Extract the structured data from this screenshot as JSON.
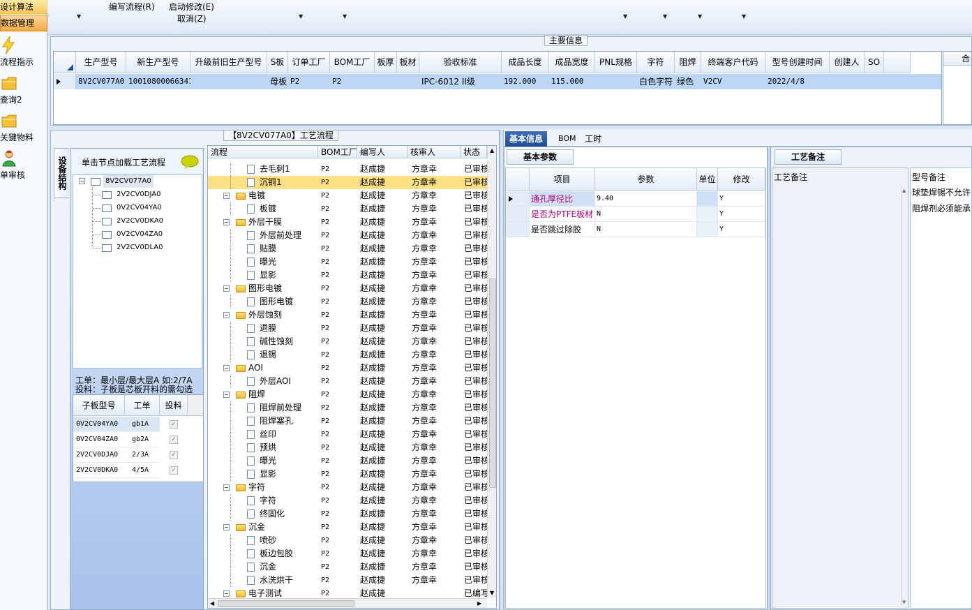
{
  "nav": {
    "items": [
      {
        "label": "设计算法"
      },
      {
        "label": "数据管理"
      },
      {
        "label": "流程指示"
      },
      {
        "label": "查询2"
      },
      {
        "label": "关键物料"
      },
      {
        "label": "单审核"
      }
    ]
  },
  "toolbar": {
    "write_flow": "编写流程(R)",
    "start_modify": "启动修改(E)",
    "cancel": "取消(Z)"
  },
  "main_info": {
    "title": "主要信息",
    "columns": [
      "生产型号",
      "新生产型号",
      "升级前旧生产型号",
      "S板",
      "订单工厂",
      "BOM工厂",
      "板厚",
      "板材",
      "验收标准",
      "成品长度",
      "成品宽度",
      "PNL规格",
      "字符",
      "阻焊",
      "终端客户代码",
      "型号创建时间",
      "创建人",
      "SO"
    ],
    "row": {
      "model": "8V2CV077A0",
      "new_model": "10010800066341",
      "old_model": "",
      "s_board": "母板",
      "order_factory": "P2",
      "bom_factory": "P2",
      "thickness": "",
      "material": "",
      "standard": "IPC-6012 II级",
      "length": "192.000",
      "width": "115.000",
      "pnl": "",
      "character": "白色字符",
      "solder": "绿色",
      "customer": "V2CV",
      "created": "2022/4/8",
      "creator": "",
      "so": ""
    },
    "right_header": "合"
  },
  "process": {
    "title": "【8V2CV077A0】工艺流程",
    "side_tab": "设备结构",
    "load_hint": "单击节点加载工艺流程",
    "tree_root": "8V2CV077A0",
    "tree_children": [
      "2V2CV0DJA0",
      "0V2CV04YA0",
      "2V2CV0DKA0",
      "0V2CV04ZA0",
      "2V2CV0DLA0"
    ],
    "note1": "工单：最小层/最大层A 如:2/7A",
    "note2": "投料：子板是芯板开料的需勾选",
    "sub_columns": [
      "子板型号",
      "工单",
      "投料"
    ],
    "sub_rows": [
      {
        "model": "0V2CV04YA0",
        "order": "gb1A"
      },
      {
        "model": "0V2CV04ZA0",
        "order": "gb2A"
      },
      {
        "model": "2V2CV0DJA0",
        "order": "2/3A"
      },
      {
        "model": "2V2CV0DKA0",
        "order": "4/5A"
      }
    ],
    "flow_columns": [
      "流程",
      "BOM工厂",
      "编写人",
      "核审人",
      "状态"
    ],
    "flow_rows": [
      {
        "name": "去毛刺1",
        "type": "doc",
        "factory": "P2",
        "writer": "赵成捷",
        "reviewer": "方章幸",
        "status": "已审核"
      },
      {
        "name": "沉铜1",
        "type": "doc",
        "factory": "P2",
        "writer": "赵成捷",
        "reviewer": "方章幸",
        "status": "已审核"
      },
      {
        "name": "电镀",
        "type": "folder",
        "factory": "P2",
        "writer": "赵成捷",
        "reviewer": "方章幸",
        "status": "已审核"
      },
      {
        "name": "板镀",
        "type": "doc",
        "factory": "P2",
        "writer": "赵成捷",
        "reviewer": "方章幸",
        "status": "已审核"
      },
      {
        "name": "外层干膜",
        "type": "folder",
        "factory": "P2",
        "writer": "赵成捷",
        "reviewer": "方章幸",
        "status": "已审核"
      },
      {
        "name": "外层前处理",
        "type": "doc",
        "factory": "P2",
        "writer": "赵成捷",
        "reviewer": "方章幸",
        "status": "已审核"
      },
      {
        "name": "贴膜",
        "type": "doc",
        "factory": "P2",
        "writer": "赵成捷",
        "reviewer": "方章幸",
        "status": "已审核"
      },
      {
        "name": "曝光",
        "type": "doc",
        "factory": "P2",
        "writer": "赵成捷",
        "reviewer": "方章幸",
        "status": "已审核"
      },
      {
        "name": "显影",
        "type": "doc",
        "factory": "P2",
        "writer": "赵成捷",
        "reviewer": "方章幸",
        "status": "已审核"
      },
      {
        "name": "图形电镀",
        "type": "folder",
        "factory": "P2",
        "writer": "赵成捷",
        "reviewer": "方章幸",
        "status": "已审核"
      },
      {
        "name": "图形电镀",
        "type": "doc",
        "factory": "P2",
        "writer": "赵成捷",
        "reviewer": "方章幸",
        "status": "已审核"
      },
      {
        "name": "外层蚀刻",
        "type": "folder",
        "factory": "P2",
        "writer": "赵成捷",
        "reviewer": "方章幸",
        "status": "已审核"
      },
      {
        "name": "退膜",
        "type": "doc",
        "factory": "P2",
        "writer": "赵成捷",
        "reviewer": "方章幸",
        "status": "已审核"
      },
      {
        "name": "碱性蚀刻",
        "type": "doc",
        "factory": "P2",
        "writer": "赵成捷",
        "reviewer": "方章幸",
        "status": "已审核"
      },
      {
        "name": "退锡",
        "type": "doc",
        "factory": "P2",
        "writer": "赵成捷",
        "reviewer": "方章幸",
        "status": "已审核"
      },
      {
        "name": "AOI",
        "type": "folder",
        "factory": "P2",
        "writer": "赵成捷",
        "reviewer": "方章幸",
        "status": "已审核"
      },
      {
        "name": "外层AOI",
        "type": "doc",
        "factory": "P2",
        "writer": "赵成捷",
        "reviewer": "方章幸",
        "status": "已审核"
      },
      {
        "name": "阻焊",
        "type": "folder",
        "factory": "P2",
        "writer": "赵成捷",
        "reviewer": "方章幸",
        "status": "已审核"
      },
      {
        "name": "阻焊前处理",
        "type": "doc",
        "factory": "P2",
        "writer": "赵成捷",
        "reviewer": "方章幸",
        "status": "已审核"
      },
      {
        "name": "阻焊塞孔",
        "type": "doc",
        "factory": "P2",
        "writer": "赵成捷",
        "reviewer": "方章幸",
        "status": "已审核"
      },
      {
        "name": "丝印",
        "type": "doc",
        "factory": "P2",
        "writer": "赵成捷",
        "reviewer": "方章幸",
        "status": "已审核"
      },
      {
        "name": "预烘",
        "type": "doc",
        "factory": "P2",
        "writer": "赵成捷",
        "reviewer": "方章幸",
        "status": "已审核"
      },
      {
        "name": "曝光",
        "type": "doc",
        "factory": "P2",
        "writer": "赵成捷",
        "reviewer": "方章幸",
        "status": "已审核"
      },
      {
        "name": "显影",
        "type": "doc",
        "factory": "P2",
        "writer": "赵成捷",
        "reviewer": "方章幸",
        "status": "已审核"
      },
      {
        "name": "字符",
        "type": "folder",
        "factory": "P2",
        "writer": "赵成捷",
        "reviewer": "方章幸",
        "status": "已审核"
      },
      {
        "name": "字符",
        "type": "doc",
        "factory": "P2",
        "writer": "赵成捷",
        "reviewer": "方章幸",
        "status": "已审核"
      },
      {
        "name": "终固化",
        "type": "doc",
        "factory": "P2",
        "writer": "赵成捷",
        "reviewer": "方章幸",
        "status": "已审核"
      },
      {
        "name": "沉金",
        "type": "folder",
        "factory": "P2",
        "writer": "赵成捷",
        "reviewer": "方章幸",
        "status": "已审核"
      },
      {
        "name": "喷砂",
        "type": "doc",
        "factory": "P2",
        "writer": "赵成捷",
        "reviewer": "方章幸",
        "status": "已审核"
      },
      {
        "name": "板边包胶",
        "type": "doc",
        "factory": "P2",
        "writer": "赵成捷",
        "reviewer": "方章幸",
        "status": "已审核"
      },
      {
        "name": "沉金",
        "type": "doc",
        "factory": "P2",
        "writer": "赵成捷",
        "reviewer": "方章幸",
        "status": "已审核"
      },
      {
        "name": "水洗烘干",
        "type": "doc",
        "factory": "P2",
        "writer": "赵成捷",
        "reviewer": "方章幸",
        "status": "已审核"
      },
      {
        "name": "电子测试",
        "type": "folder",
        "factory": "P2",
        "writer": "赵成捷",
        "reviewer": "",
        "status": "已编写"
      }
    ]
  },
  "right": {
    "tabs": [
      "基本信息",
      "BOM",
      "工时"
    ],
    "params_tab": "基本参数",
    "param_columns": [
      "项目",
      "参数",
      "单位",
      "修改"
    ],
    "param_rows": [
      {
        "item": "通孔厚径比",
        "value": "9.40",
        "unit": "",
        "edit": "Y",
        "highlight": true
      },
      {
        "item": "是否为PTFE板材",
        "value": "N",
        "unit": "",
        "edit": "Y",
        "highlight": true
      },
      {
        "item": "是否跳过除胶",
        "value": "N",
        "unit": "",
        "edit": "Y",
        "highlight": false
      }
    ],
    "notes_tab": "工艺备注",
    "notes_col1": "工艺备注",
    "notes_col2": "型号备注",
    "model_note_1": "球垫焊锡不允许",
    "model_note_2": "阻焊剂必须能承受"
  },
  "colors": {
    "accent": "#1f4f99",
    "selected_row": "#bcd6f5",
    "selected_flow": "#ffe083",
    "highlight_text": "#b0007a"
  }
}
